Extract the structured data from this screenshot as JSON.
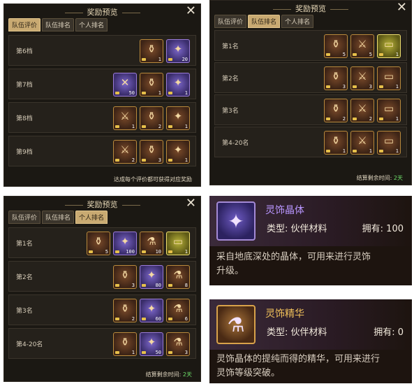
{
  "panel_a": {
    "title": "奖励预览",
    "tabs": [
      "队伍评价",
      "队伍排名",
      "个人排名"
    ],
    "rows": [
      {
        "label": "第6档",
        "items": [
          {
            "icon": "chest",
            "count": "1",
            "style": "brown"
          },
          {
            "icon": "crystal",
            "count": "20",
            "style": "purple"
          }
        ]
      },
      {
        "label": "第7档",
        "items": [
          {
            "icon": "pouch",
            "count": "50",
            "style": "purple"
          },
          {
            "icon": "chest",
            "count": "1",
            "style": "brown"
          },
          {
            "icon": "crystal",
            "count": "1",
            "style": "purple"
          }
        ]
      },
      {
        "label": "第8档",
        "items": [
          {
            "icon": "sword",
            "count": "1",
            "style": "brown"
          },
          {
            "icon": "chest",
            "count": "2",
            "style": "brown"
          },
          {
            "icon": "crystal",
            "count": "1",
            "style": "brown"
          }
        ]
      },
      {
        "label": "第9档",
        "items": [
          {
            "icon": "sword",
            "count": "2",
            "style": "brown"
          },
          {
            "icon": "chest",
            "count": "3",
            "style": "brown"
          },
          {
            "icon": "crystal",
            "count": "1",
            "style": "brown"
          }
        ]
      }
    ],
    "footer": "达成每个评价都可获得对应奖励"
  },
  "panel_b": {
    "title": "奖励预览",
    "tabs": [
      "队伍评价",
      "队伍排名",
      "个人排名"
    ],
    "rows": [
      {
        "label": "第1名",
        "items": [
          {
            "icon": "chest",
            "count": "5",
            "style": "brown"
          },
          {
            "icon": "sword",
            "count": "5",
            "style": "brown"
          },
          {
            "icon": "ticket",
            "count": "1",
            "style": "gold"
          }
        ]
      },
      {
        "label": "第2名",
        "items": [
          {
            "icon": "chest",
            "count": "3",
            "style": "brown"
          },
          {
            "icon": "sword",
            "count": "3",
            "style": "brown"
          },
          {
            "icon": "ticket",
            "count": "1",
            "style": "brown"
          }
        ]
      },
      {
        "label": "第3名",
        "items": [
          {
            "icon": "chest",
            "count": "2",
            "style": "brown"
          },
          {
            "icon": "sword",
            "count": "2",
            "style": "brown"
          },
          {
            "icon": "ticket",
            "count": "1",
            "style": "brown"
          }
        ]
      },
      {
        "label": "第4-20名",
        "items": [
          {
            "icon": "chest",
            "count": "1",
            "style": "brown"
          },
          {
            "icon": "sword",
            "count": "1",
            "style": "brown"
          },
          {
            "icon": "ticket",
            "count": "1",
            "style": "brown"
          }
        ]
      }
    ],
    "footer_label": "结算剩余时间:",
    "footer_value": "2天"
  },
  "panel_c": {
    "title": "奖励预览",
    "tabs": [
      "队伍评价",
      "队伍排名",
      "个人排名"
    ],
    "rows": [
      {
        "label": "第1名",
        "items": [
          {
            "icon": "chest",
            "count": "5",
            "style": "brown"
          },
          {
            "icon": "crystal",
            "count": "100",
            "style": "purple"
          },
          {
            "icon": "flask",
            "count": "10",
            "style": "brown"
          },
          {
            "icon": "ticket",
            "count": "1",
            "style": "gold"
          }
        ]
      },
      {
        "label": "第2名",
        "items": [
          {
            "icon": "chest",
            "count": "3",
            "style": "brown"
          },
          {
            "icon": "crystal",
            "count": "80",
            "style": "purple"
          },
          {
            "icon": "flask",
            "count": "8",
            "style": "brown"
          }
        ]
      },
      {
        "label": "第3名",
        "items": [
          {
            "icon": "chest",
            "count": "2",
            "style": "brown"
          },
          {
            "icon": "crystal",
            "count": "60",
            "style": "purple"
          },
          {
            "icon": "flask",
            "count": "6",
            "style": "brown"
          }
        ]
      },
      {
        "label": "第4-20名",
        "items": [
          {
            "icon": "chest",
            "count": "1",
            "style": "brown"
          },
          {
            "icon": "crystal",
            "count": "50",
            "style": "purple"
          },
          {
            "icon": "flask",
            "count": "3",
            "style": "brown"
          }
        ]
      }
    ],
    "footer_label": "结算剩余时间:",
    "footer_value": "2天"
  },
  "card_crystal": {
    "name": "灵饰晶体",
    "type": "类型: 伙伴材料",
    "own": "拥有: 100",
    "desc_line1": "采自地底深处的晶体，可用来进行灵饰",
    "desc_line2": "升级。"
  },
  "card_essence": {
    "name": "灵饰精华",
    "type": "类型: 伙伴材料",
    "own": "拥有: 0",
    "desc_line1": "灵饰晶体的提纯而得的精华，可用来进行",
    "desc_line2": "灵饰等级突破。"
  },
  "close_glyph": "✕",
  "icon_glyphs": {
    "chest": "⚱",
    "crystal": "✦",
    "sword": "⚔",
    "ticket": "▭",
    "pouch": "✕",
    "flask": "⚗"
  }
}
